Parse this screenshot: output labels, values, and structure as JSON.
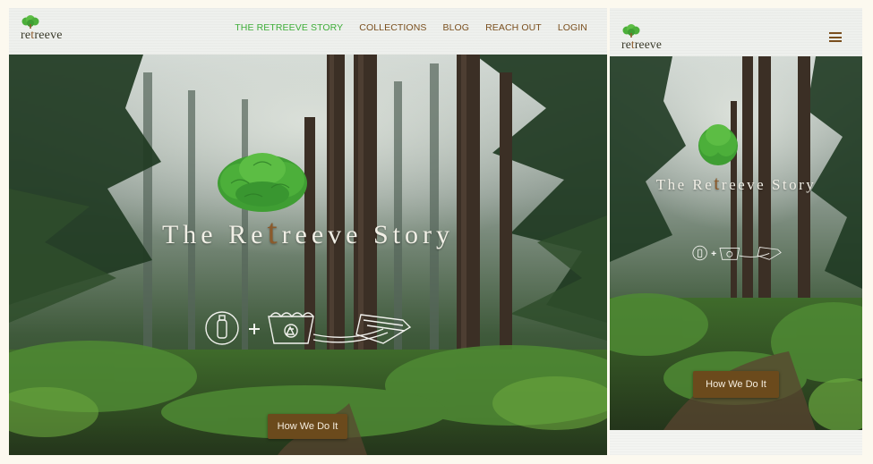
{
  "brand": {
    "logo_prefix": "re",
    "logo_t": "t",
    "logo_suffix": "reeve"
  },
  "nav": {
    "items": [
      {
        "label": "THE RETREEVE STORY",
        "active": true
      },
      {
        "label": "COLLECTIONS",
        "active": false
      },
      {
        "label": "BLOG",
        "active": false
      },
      {
        "label": "REACH OUT",
        "active": false
      },
      {
        "label": "LOGIN",
        "active": false
      }
    ]
  },
  "hero": {
    "title_prefix": "The Re",
    "title_t": "t",
    "title_suffix": "reeve Story",
    "cta_label": "How We Do It"
  },
  "colors": {
    "accent_green": "#3fae3a",
    "nav_brown": "#7a4f1e",
    "cta_brown": "#6b4a1c",
    "page_bg": "#fcf9ef"
  },
  "icons": [
    "tree-logo-icon",
    "bottle-icon",
    "plus-icon",
    "recycle-bin-icon",
    "folded-fabric-icon",
    "hamburger-menu-icon"
  ]
}
